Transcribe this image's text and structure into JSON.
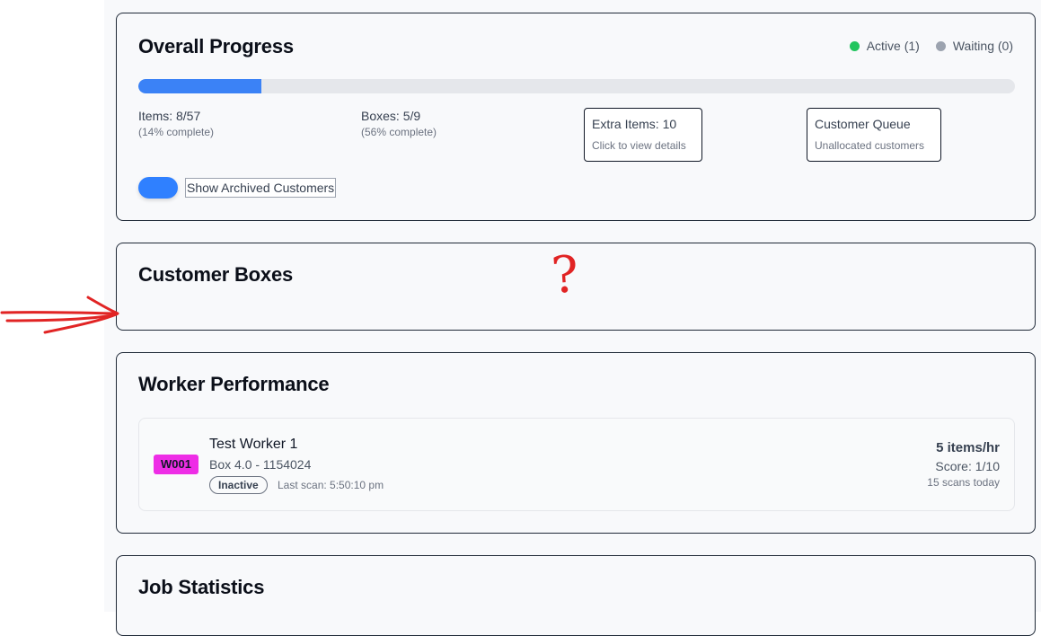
{
  "overall": {
    "title": "Overall Progress",
    "legend": {
      "active_label": "Active (1)",
      "active_color": "#22c55e",
      "waiting_label": "Waiting (0)",
      "waiting_color": "#9ca3af"
    },
    "progress_fraction": 0.14,
    "items": {
      "main": "Items: 8/57",
      "sub": "(14% complete)"
    },
    "boxes": {
      "main": "Boxes: 5/9",
      "sub": "(56% complete)"
    },
    "extra_items": {
      "main": "Extra Items: 10",
      "sub": "Click to view details"
    },
    "customer_queue": {
      "main": "Customer Queue",
      "sub": "Unallocated customers"
    },
    "archived_toggle_label": "Show Archived Customers"
  },
  "customer_boxes": {
    "title": "Customer Boxes"
  },
  "worker_performance": {
    "title": "Worker Performance",
    "workers": [
      {
        "id": "W001",
        "id_color": "#ee2de6",
        "name": "Test Worker 1",
        "box": "Box 4.0 - 1154024",
        "status": "Inactive",
        "last_scan": "Last scan: 5:50:10 pm",
        "rate": "5 items/hr",
        "score": "Score: 1/10",
        "scans_today": "15 scans today"
      }
    ]
  },
  "job_statistics": {
    "title": "Job Statistics"
  },
  "annotation": {
    "question_mark": "?",
    "color": "#e12424"
  }
}
